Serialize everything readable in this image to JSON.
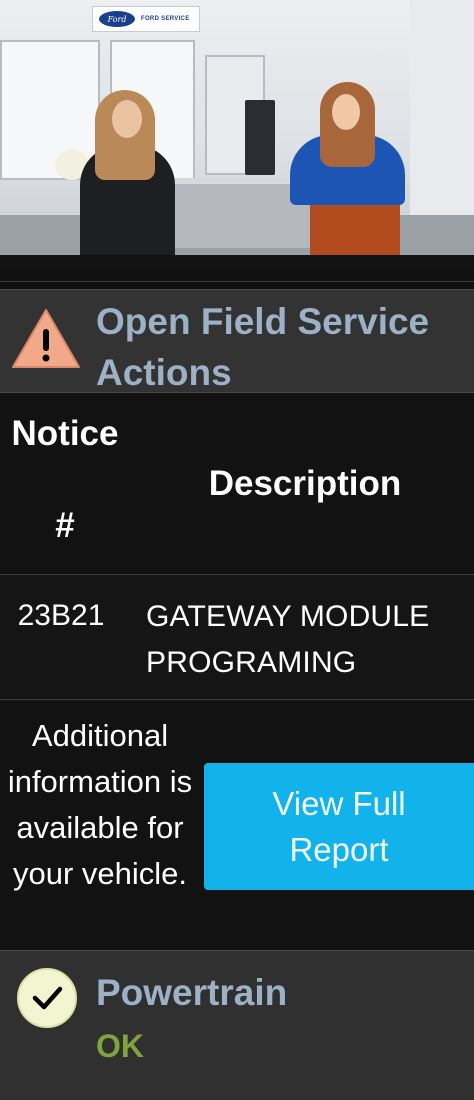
{
  "hero": {
    "sign_logo": "Ford",
    "sign_text": "FORD SERVICE"
  },
  "field_service": {
    "icon": "warning-triangle-icon",
    "title": "Open Field Service Actions",
    "columns": {
      "notice_line1": "Notice",
      "notice_line2": "#",
      "description": "Description"
    },
    "rows": [
      {
        "notice": "23B21",
        "description": "GATEWAY MODULE PROGRAMING"
      }
    ],
    "additional_info": "Additional information is available for your vehicle.",
    "report_button": "View Full Report"
  },
  "powertrain": {
    "icon": "checkmark-circle-icon",
    "title": "Powertrain",
    "status": "OK"
  },
  "colors": {
    "title_blue": "#9db1c6",
    "button_blue": "#12b2ea",
    "ok_green": "#7ea43f",
    "warning_fill": "#f2a98a"
  }
}
